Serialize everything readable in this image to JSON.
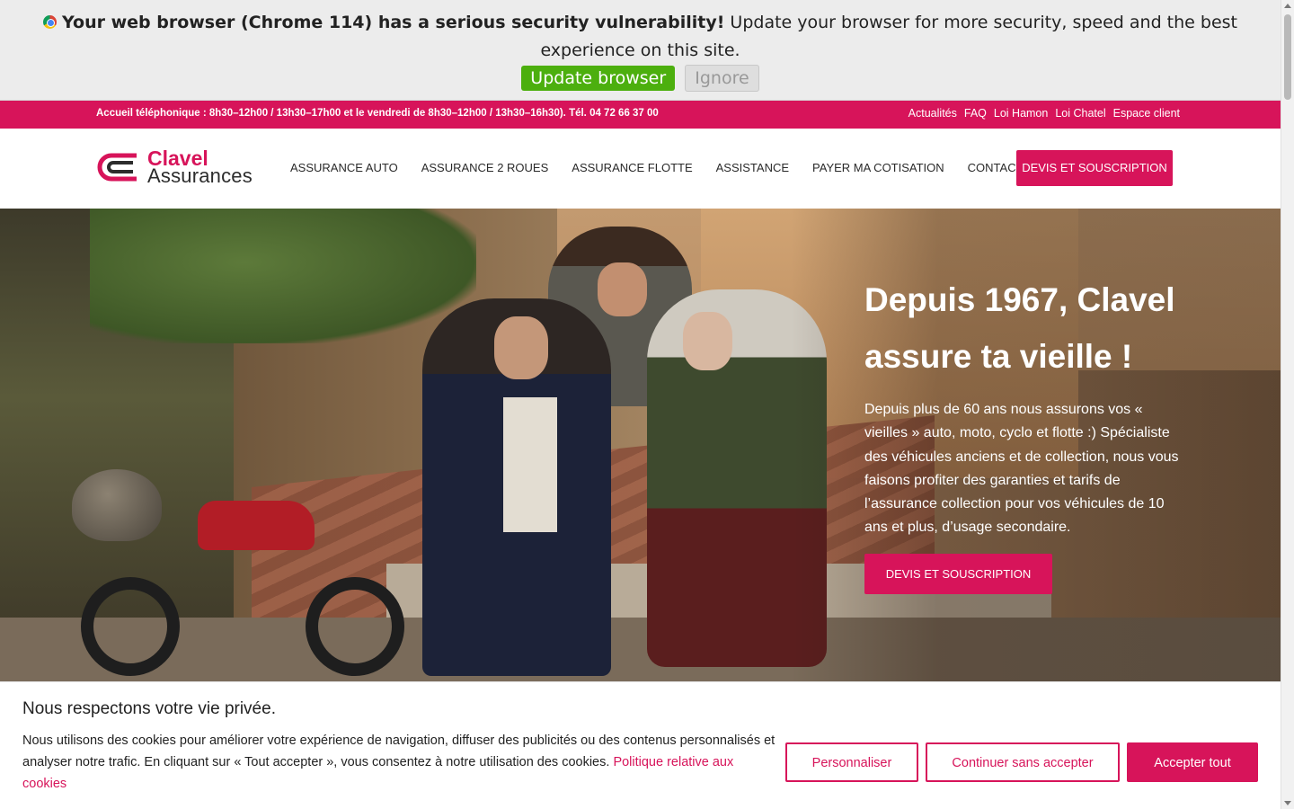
{
  "update_banner": {
    "warning_bold": "Your web browser (Chrome 114) has a serious security vulnerability!",
    "warning_text": " Update your browser for more security, speed and the best experience on this site.",
    "update_label": "Update browser",
    "ignore_label": "Ignore"
  },
  "top_strip": {
    "hours": "Accueil téléphonique : 8h30–12h00 / 13h30–17h00 et le vendredi de 8h30–12h00 / 13h30–16h30). Tél. 04 72 66 37 00",
    "links": [
      "Actualités",
      "FAQ",
      "Loi Hamon",
      "Loi Chatel",
      "Espace client"
    ]
  },
  "header": {
    "logo_line1": "Clavel",
    "logo_line2": "Assurances",
    "nav": [
      "ASSURANCE AUTO",
      "ASSURANCE 2 ROUES",
      "ASSURANCE FLOTTE",
      "ASSISTANCE",
      "PAYER MA COTISATION",
      "CONTACT"
    ],
    "cta": "DEVIS ET SOUSCRIPTION"
  },
  "hero": {
    "title": "Depuis 1967, Clavel assure ta vieille !",
    "description": "Depuis plus de 60 ans nous assurons vos « vieilles » auto, moto, cyclo et flotte :) Spécialiste des véhicules anciens et de collection, nous vous faisons profiter des garanties et tarifs de l’assurance collection pour vos véhicules de 10 ans et plus, d’usage secondaire.",
    "cta": "DEVIS ET SOUSCRIPTION"
  },
  "cookie": {
    "title": "Nous respectons votre vie privée.",
    "text": "Nous utilisons des cookies pour améliorer votre expérience de navigation, diffuser des publicités ou des contenus personnalisés et analyser notre trafic. En cliquant sur « Tout accepter », vous consentez à notre utilisation des cookies. ",
    "policy_link": "Politique relative aux cookies",
    "personalize": "Personnaliser",
    "continue": "Continuer sans accepter",
    "accept": "Accepter tout"
  },
  "colors": {
    "brand": "#d7145a",
    "update_green": "#4caf0e"
  }
}
